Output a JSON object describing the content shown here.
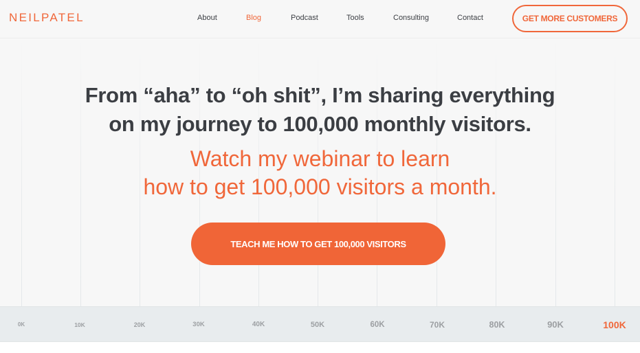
{
  "header": {
    "logo": "NEILPATEL",
    "nav": [
      {
        "label": "About",
        "active": false
      },
      {
        "label": "Blog",
        "active": true
      },
      {
        "label": "Podcast",
        "active": false
      },
      {
        "label": "Tools",
        "active": false
      },
      {
        "label": "Consulting",
        "active": false
      },
      {
        "label": "Contact",
        "active": false
      }
    ],
    "cta_label": "GET MORE CUSTOMERS"
  },
  "hero": {
    "title_line1": "From “aha” to “oh shit”, I’m sharing everything",
    "title_line2": "on my journey to 100,000 monthly visitors.",
    "subtitle_line1": "Watch my webinar to learn",
    "subtitle_line2": "how to get 100,000 visitors a month.",
    "cta_label": "TEACH ME HOW TO GET 100,000 VISITORS"
  },
  "progress_scale": {
    "ticks": [
      "0K",
      "10K",
      "20K",
      "30K",
      "40K",
      "50K",
      "60K",
      "70K",
      "80K",
      "90K",
      "100K"
    ],
    "highlighted_tick": "100K"
  },
  "colors": {
    "brand": "#f0673a",
    "text": "#3b3e43",
    "tick_text": "#9c9fa2",
    "axis_bg": "#e8ecee"
  }
}
